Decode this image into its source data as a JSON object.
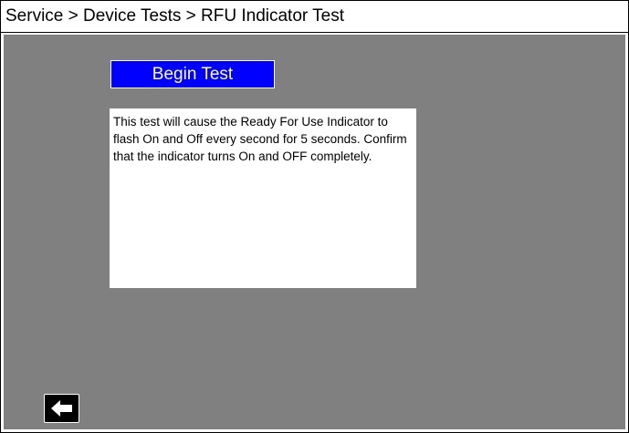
{
  "header": {
    "breadcrumb": "Service > Device Tests > RFU Indicator Test"
  },
  "main": {
    "begin_button_label": "Begin Test",
    "description": "This test will cause the Ready For Use Indicator to flash On and Off every second for 5 seconds.  Confirm that the indicator turns On and OFF completely."
  },
  "footer": {
    "back_icon": "arrow-left-icon"
  },
  "colors": {
    "panel_background": "#808080",
    "button_accent": "#0000ff",
    "back_button": "#000000"
  }
}
